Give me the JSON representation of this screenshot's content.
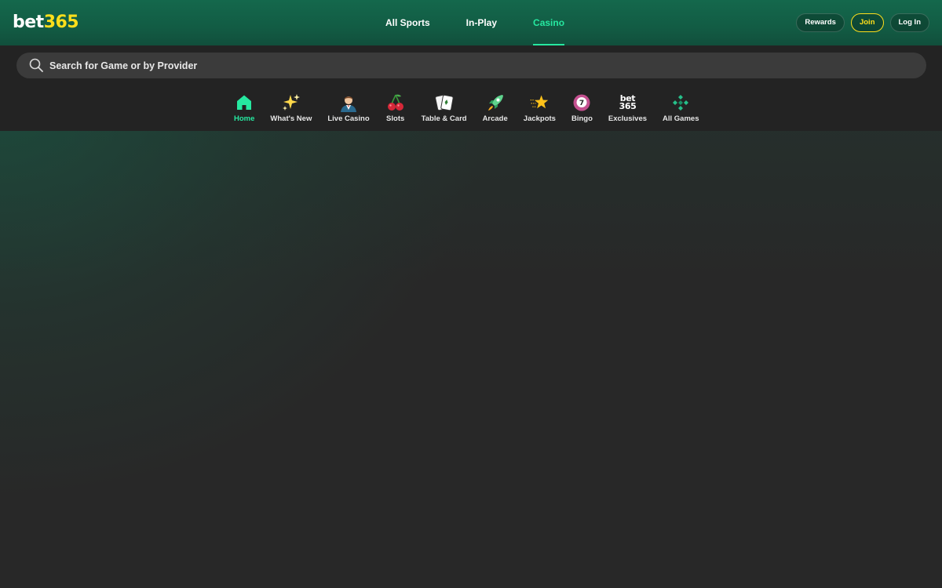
{
  "header": {
    "logo": {
      "part1": "bet",
      "part2": "365"
    },
    "tabs": [
      {
        "label": "All Sports",
        "active": false
      },
      {
        "label": "In-Play",
        "active": false
      },
      {
        "label": "Casino",
        "active": true
      }
    ],
    "buttons": {
      "rewards": "Rewards",
      "join": "Join",
      "login": "Log In"
    }
  },
  "search": {
    "placeholder": "Search for Game or by Provider",
    "value": ""
  },
  "categories": [
    {
      "label": "Home",
      "icon": "home-icon",
      "active": true
    },
    {
      "label": "What's New",
      "icon": "sparkles-icon",
      "active": false
    },
    {
      "label": "Live Casino",
      "icon": "dealer-icon",
      "active": false
    },
    {
      "label": "Slots",
      "icon": "cherries-icon",
      "active": false
    },
    {
      "label": "Table & Card",
      "icon": "cards-icon",
      "active": false
    },
    {
      "label": "Arcade",
      "icon": "rocket-icon",
      "active": false
    },
    {
      "label": "Jackpots",
      "icon": "star-icon",
      "active": false
    },
    {
      "label": "Bingo",
      "icon": "bingo-ball-icon",
      "active": false,
      "ball_number": "7"
    },
    {
      "label": "Exclusives",
      "icon": "bet365-icon",
      "active": false,
      "mark_top": "bet",
      "mark_bottom": "365"
    },
    {
      "label": "All Games",
      "icon": "diamonds-grid-icon",
      "active": false
    }
  ],
  "colors": {
    "accent": "#26e8a0",
    "brand_yellow": "#ffdf1b",
    "header_green": "#14684c",
    "background": "#282828"
  }
}
